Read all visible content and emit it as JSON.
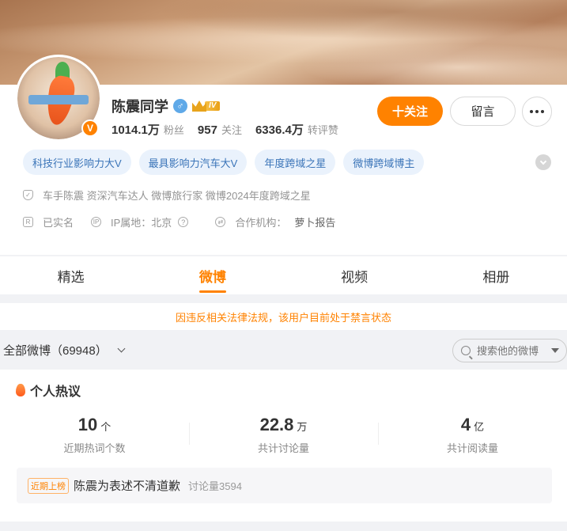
{
  "profile": {
    "name": "陈震同学",
    "avatar_badge": "V",
    "level": "IV",
    "stats": [
      {
        "num": "1014.1万",
        "label": "粉丝"
      },
      {
        "num": "957",
        "label": "关注"
      },
      {
        "num": "6336.4万",
        "label": "转评赞"
      }
    ],
    "follow_label": "十关注",
    "message_label": "留言",
    "tags": [
      "科技行业影响力大V",
      "最具影响力汽车大V",
      "年度跨域之星",
      "微博跨域博主"
    ],
    "bio": "车手陈震 资深汽车达人 微博旅行家 微博2024年度跨域之星",
    "verified": "已实名",
    "ip_label": "IP属地：北京",
    "partner_label": "合作机构：",
    "partner_value": "萝卜报告"
  },
  "tabs": [
    "精选",
    "微博",
    "视频",
    "相册"
  ],
  "active_tab": "微博",
  "notice": "因违反相关法律法规，该用户目前处于禁言状态",
  "feed": {
    "title": "全部微博（69948）",
    "search_placeholder": "搜索他的微博"
  },
  "hot": {
    "title": "个人热议",
    "metrics": [
      {
        "num": "10",
        "unit": "个",
        "label": "近期热词个数"
      },
      {
        "num": "22.8",
        "unit": "万",
        "label": "共计讨论量"
      },
      {
        "num": "4",
        "unit": "亿",
        "label": "共计阅读量"
      }
    ],
    "item": {
      "badge": "近期上榜",
      "text": "陈震为表述不清道歉",
      "count": "讨论量3594"
    }
  },
  "colors": {
    "accent": "#ff8200",
    "tag_text": "#3a74b8",
    "tag_bg": "#eaf2fc"
  },
  "icons": [
    "shield-icon",
    "id-card-icon",
    "ip-icon",
    "question-icon",
    "handshake-icon",
    "search-icon",
    "flame-icon",
    "more-icon",
    "expand-icon"
  ]
}
